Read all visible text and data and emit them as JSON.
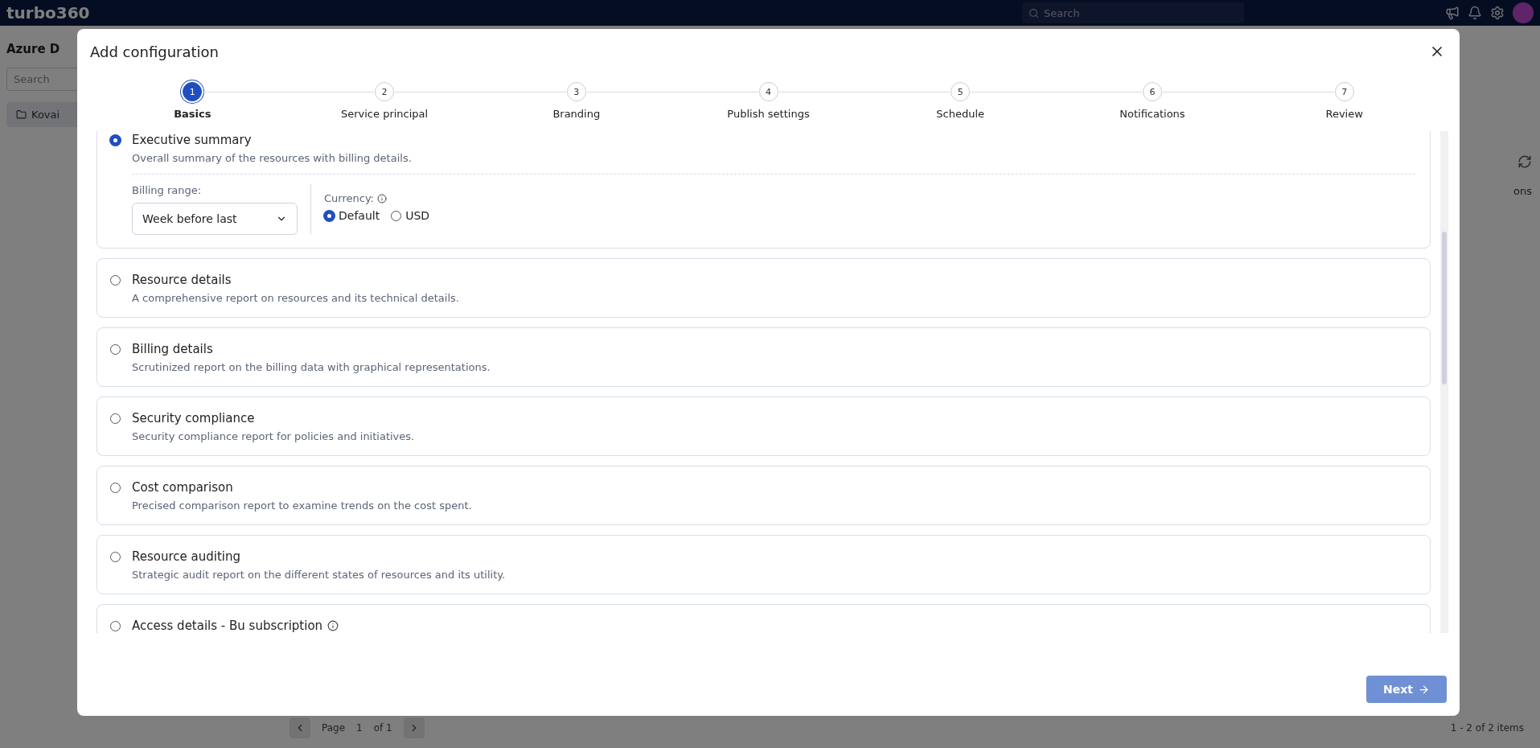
{
  "app": {
    "brand": "turbo360",
    "search_placeholder": "Search",
    "sidebar_title": "Azure D",
    "sidebar_search_placeholder": "Search",
    "sidebar_item": "Kovai",
    "action_header": "ons",
    "pager": {
      "page_label": "Page",
      "page_value": "1",
      "of": "of 1",
      "summary": "1 - 2 of 2 items"
    }
  },
  "dialog": {
    "title": "Add configuration",
    "steps": [
      {
        "number": "1",
        "label": "Basics",
        "selected": true
      },
      {
        "number": "2",
        "label": "Service principal",
        "selected": false
      },
      {
        "number": "3",
        "label": "Branding",
        "selected": false
      },
      {
        "number": "4",
        "label": "Publish settings",
        "selected": false
      },
      {
        "number": "5",
        "label": "Schedule",
        "selected": false
      },
      {
        "number": "6",
        "label": "Notifications",
        "selected": false
      },
      {
        "number": "7",
        "label": "Review",
        "selected": false
      }
    ],
    "reports": [
      {
        "title": "Executive summary",
        "description": "Overall summary of the resources with billing details.",
        "selected": true,
        "options": {
          "billing_label": "Billing range:",
          "billing_value": "Week before last",
          "currency_label": "Currency:",
          "currencies": [
            {
              "label": "Default",
              "selected": true
            },
            {
              "label": "USD",
              "selected": false
            }
          ]
        }
      },
      {
        "title": "Resource details",
        "description": "A comprehensive report on resources and its technical details.",
        "selected": false
      },
      {
        "title": "Billing details",
        "description": "Scrutinized report on the billing data with graphical representations.",
        "selected": false
      },
      {
        "title": "Security compliance",
        "description": "Security compliance report for policies and initiatives.",
        "selected": false
      },
      {
        "title": "Cost comparison",
        "description": "Precised comparison report to examine trends on the cost spent.",
        "selected": false
      },
      {
        "title": "Resource auditing",
        "description": "Strategic audit report on the different states of resources and its utility.",
        "selected": false
      },
      {
        "title": "Access details - Bu subscription",
        "selected": false,
        "info": true
      }
    ],
    "next_button": "Next"
  }
}
